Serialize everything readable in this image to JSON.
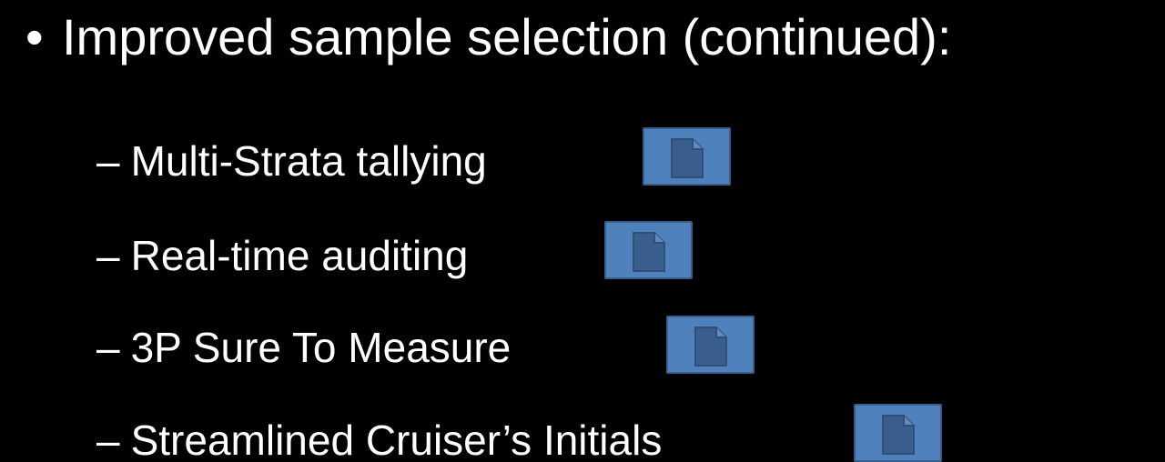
{
  "slide": {
    "bullet_symbol": "•",
    "heading": "Improved sample selection (continued):",
    "items": [
      {
        "dash": "–",
        "label": "Multi-Strata tallying",
        "icon": "document-icon"
      },
      {
        "dash": "–",
        "label": "Real-time auditing",
        "icon": "document-icon"
      },
      {
        "dash": "–",
        "label": "3P Sure To Measure",
        "icon": "document-icon"
      },
      {
        "dash": "–",
        "label": "Streamlined Cruiser’s Initials",
        "icon": "document-icon"
      }
    ]
  },
  "colors": {
    "background": "#000000",
    "text": "#ffffff",
    "button_fill": "#4f81bd",
    "button_border": "#385d8a",
    "icon_fill": "#3a5f8f"
  }
}
